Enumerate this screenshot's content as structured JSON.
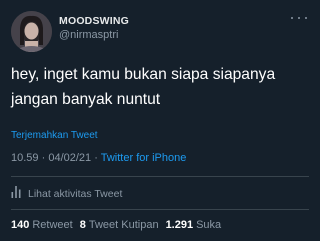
{
  "user": {
    "display_name": "MOODSWING",
    "handle": "@nirmasptri"
  },
  "tweet": {
    "text_line1": "hey, inget kamu bukan siapa siapanya",
    "text_line2": "jangan banyak nuntut",
    "translate_label": "Terjemahkan Tweet",
    "time": "10.59",
    "date": "04/02/21",
    "separator": "·",
    "source": "Twitter for iPhone"
  },
  "activity": {
    "label": "Lihat aktivitas Tweet",
    "icon": "bar-chart-icon"
  },
  "stats": {
    "retweets_count": "140",
    "retweets_label": "Retweet",
    "quotes_count": "8",
    "quotes_label": "Tweet Kutipan",
    "likes_count": "1.291",
    "likes_label": "Suka"
  },
  "colors": {
    "background": "#15202b",
    "text_primary": "#ffffff",
    "text_secondary": "#8b98a5",
    "accent": "#1d9bf0",
    "divider": "#38444d"
  }
}
